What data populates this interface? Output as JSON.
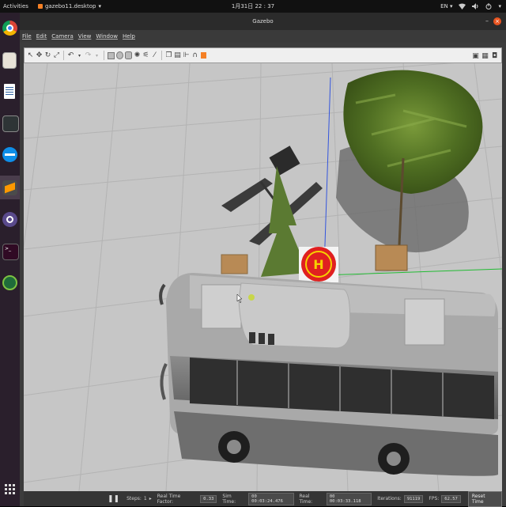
{
  "topbar": {
    "activities": "Activities",
    "app_menu": "gazebo11.desktop",
    "app_menu_arrow": "▾",
    "clock": "1月31日  22 : 37",
    "input_method": "EN",
    "tray_icons": [
      "network-icon",
      "volume-icon",
      "power-icon"
    ]
  },
  "dock": {
    "items": [
      "chrome-icon",
      "files-icon",
      "text-editor-icon",
      "terminal-window-icon",
      "teamviewer-icon",
      "sublime-icon",
      "gazebo-icon",
      "terminal-icon",
      "qgroundcontrol-icon",
      "app-grid-icon"
    ]
  },
  "window": {
    "title": "Gazebo",
    "minimize": "–",
    "close": "×"
  },
  "menubar": {
    "items": [
      "File",
      "Edit",
      "Camera",
      "View",
      "Window",
      "Help"
    ]
  },
  "toolbar": {
    "tools": [
      "select-icon",
      "translate-icon",
      "rotate-icon",
      "scale-icon",
      "undo-icon",
      "redo-icon",
      "box-icon",
      "sphere-icon",
      "cylinder-icon",
      "point-light-icon",
      "spot-light-icon",
      "directional-light-icon",
      "copy-icon",
      "paste-icon",
      "align-icon",
      "snap-icon",
      "camera-mode-icon"
    ],
    "right_tools": [
      "screenshot-icon",
      "log-icon",
      "record-icon"
    ]
  },
  "scene": {
    "landing_pad_letter": "H"
  },
  "bottom": {
    "pause_icon": "❚❚",
    "steps_label": "Steps:",
    "steps_value": "1",
    "real_time_factor_label": "Real Time Factor:",
    "real_time_factor_value": "0.33",
    "sim_time_label": "Sim Time:",
    "sim_time_value": "00 00:03:24.476",
    "real_time_label": "Real Time:",
    "real_time_value": "00 00:03:33.118",
    "iterations_label": "Iterations:",
    "iterations_value": "91119",
    "fps_label": "FPS:",
    "fps_value": "62.57",
    "reset_button": "Reset Time"
  }
}
